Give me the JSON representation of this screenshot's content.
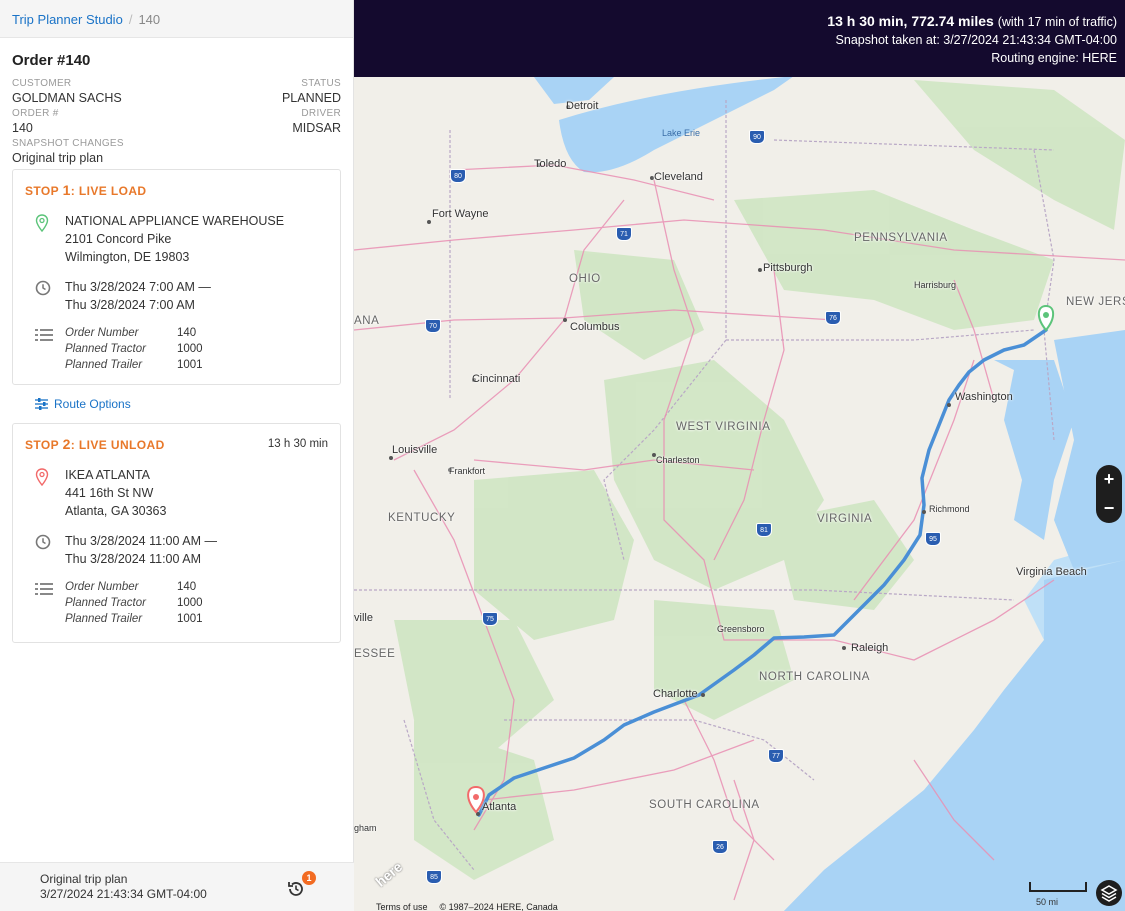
{
  "breadcrumb": {
    "root": "Trip Planner Studio",
    "current": "140"
  },
  "order": {
    "title": "Order #140",
    "customer_label": "CUSTOMER",
    "customer": "GOLDMAN SACHS",
    "status_label": "STATUS",
    "status": "PLANNED",
    "order_num_label": "ORDER #",
    "order_num": "140",
    "driver_label": "DRIVER",
    "driver": "MIDSAR",
    "snapshot_label": "SNAPSHOT CHANGES",
    "snapshot": "Original trip plan"
  },
  "stops": [
    {
      "title_prefix": "STOP ",
      "title_num": "1",
      "title_suffix": ": LIVE LOAD",
      "duration": "",
      "name": "NATIONAL APPLIANCE WAREHOUSE",
      "street": "2101 Concord Pike",
      "city": "Wilmington, DE 19803",
      "time_start": "Thu 3/28/2024 7:00 AM —",
      "time_end": "Thu 3/28/2024 7:00 AM",
      "meta": [
        {
          "key": "Order Number",
          "val": "140"
        },
        {
          "key": "Planned Tractor",
          "val": "1000"
        },
        {
          "key": "Planned Trailer",
          "val": "1001"
        }
      ],
      "pin_color": "#5cc47a"
    },
    {
      "title_prefix": "STOP ",
      "title_num": "2",
      "title_suffix": ": LIVE UNLOAD",
      "duration": "13 h 30 min",
      "name": "IKEA ATLANTA",
      "street": "441 16th St NW",
      "city": "Atlanta, GA 30363",
      "time_start": "Thu 3/28/2024 11:00 AM —",
      "time_end": "Thu 3/28/2024 11:00 AM",
      "meta": [
        {
          "key": "Order Number",
          "val": "140"
        },
        {
          "key": "Planned Tractor",
          "val": "1000"
        },
        {
          "key": "Planned Trailer",
          "val": "1001"
        }
      ],
      "pin_color": "#f26a6a"
    }
  ],
  "route_options": "Route Options",
  "footer": {
    "line1": "Original trip plan",
    "line2": "3/27/2024 21:43:34 GMT-04:00",
    "badge": "1"
  },
  "banner": {
    "summary": "13 h 30 min, 772.74 miles",
    "traffic": "(with 17 min of traffic)",
    "snapshot": "Snapshot taken at: 3/27/2024 21:43:34 GMT-04:00",
    "engine": "Routing engine: HERE"
  },
  "map": {
    "zoom_in": "+",
    "zoom_out": "−",
    "scale": "50 mi",
    "terms": "Terms of use",
    "copyright": "© 1987–2024 HERE, Canada",
    "logo": "here",
    "cities": {
      "detroit": "Detroit",
      "toledo": "Toledo",
      "cleveland": "Cleveland",
      "fort_wayne": "Fort Wayne",
      "pittsburgh": "Pittsburgh",
      "harrisburg": "Harrisburg",
      "columbus": "Columbus",
      "cincinnati": "Cincinnati",
      "washington": "Washington",
      "louisville": "Louisville",
      "frankfort": "Frankfort",
      "charleston": "Charleston",
      "richmond": "Richmond",
      "virginia_beach": "Virginia Beach",
      "greensboro": "Greensboro",
      "raleigh": "Raleigh",
      "charlotte": "Charlotte",
      "atlanta": "Atlanta",
      "ville": "ville",
      "gham": "gham"
    },
    "states": {
      "pennsylvania": "PENNSYLVANIA",
      "new_jersey": "NEW JERS",
      "ohio": "OHIO",
      "west_virginia": "WEST VIRGINIA",
      "kentucky": "KENTUCKY",
      "virginia": "VIRGINIA",
      "north_carolina": "NORTH CAROLINA",
      "south_carolina": "SOUTH CAROLINA",
      "tennessee": "ESSEE",
      "indiana": "ANA"
    },
    "water": {
      "lake_erie": "Lake Erie"
    },
    "shields": [
      "90",
      "80",
      "71",
      "70",
      "76",
      "95",
      "81",
      "75",
      "77",
      "85",
      "26"
    ]
  }
}
